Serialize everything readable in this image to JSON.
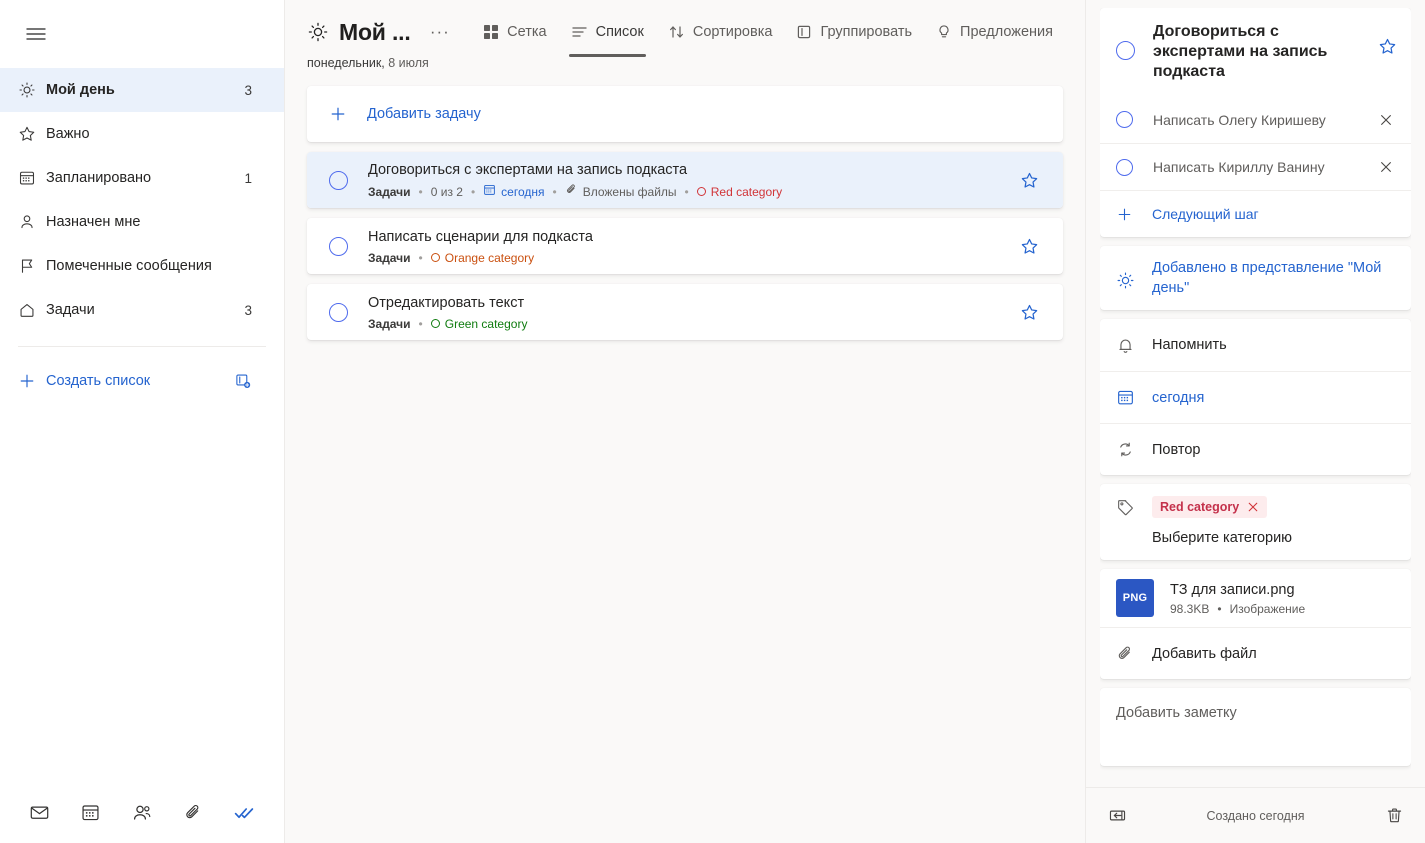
{
  "colors": {
    "accent": "#2564cf",
    "selected_bg": "#eaf1fb",
    "app_bg": "#faf9f8",
    "red": "#d13438",
    "orange": "#ca5010",
    "green": "#107c10",
    "chip_bg": "#fdeced",
    "chip_text": "#c4314b",
    "png_badge": "#2b57c3"
  },
  "sidebar": {
    "menu_icon": "hamburger-icon",
    "items": [
      {
        "label": "Мой день",
        "count": "3",
        "icon": "sun-icon",
        "selected": true
      },
      {
        "label": "Важно",
        "count": "",
        "icon": "star-icon",
        "selected": false
      },
      {
        "label": "Запланировано",
        "count": "1",
        "icon": "calendar-icon",
        "selected": false
      },
      {
        "label": "Назначен мне",
        "count": "",
        "icon": "person-icon",
        "selected": false
      },
      {
        "label": "Помеченные сообщения",
        "count": "",
        "icon": "flag-icon",
        "selected": false
      },
      {
        "label": "Задачи",
        "count": "3",
        "icon": "home-icon",
        "selected": false
      }
    ],
    "create_list": {
      "label": "Создать список",
      "plus_icon": "plus-icon",
      "new_group_icon": "new-list-group-icon"
    },
    "footer_icons": [
      {
        "icon": "mail-icon",
        "active": false
      },
      {
        "icon": "calendar-icon",
        "active": false
      },
      {
        "icon": "people-icon",
        "active": false
      },
      {
        "icon": "attachment-icon",
        "active": false
      },
      {
        "icon": "tasks-check-icon",
        "active": true
      }
    ]
  },
  "header": {
    "sun_icon": "sun-icon",
    "title": "Мой ...",
    "more_label": "···",
    "subtitle_day": "понедельник,",
    "subtitle_date": " 8 июля",
    "tools": [
      {
        "label": "Сетка",
        "icon": "grid-icon",
        "active": false
      },
      {
        "label": "Список",
        "icon": "list-icon",
        "active": true
      },
      {
        "label": "Сортировка",
        "icon": "sort-icon",
        "active": false
      },
      {
        "label": "Группировать",
        "icon": "group-icon",
        "active": false
      },
      {
        "label": "Предложения",
        "icon": "lightbulb-icon",
        "active": false
      }
    ]
  },
  "main": {
    "add_task_label": "Добавить задачу",
    "tasks": [
      {
        "title": "Договориться с экспертами на запись подкаста",
        "selected": true,
        "meta": {
          "list": "Задачи",
          "steps": "0 из 2",
          "due": "сегодня",
          "attachments": "Вложены файлы",
          "category": "Red category",
          "category_color": "red"
        }
      },
      {
        "title": "Написать сценарии для подкаста",
        "selected": false,
        "meta": {
          "list": "Задачи",
          "steps": "",
          "due": "",
          "attachments": "",
          "category": "Orange category",
          "category_color": "orange"
        }
      },
      {
        "title": "Отредактировать текст",
        "selected": false,
        "meta": {
          "list": "Задачи",
          "steps": "",
          "due": "",
          "attachments": "",
          "category": "Green category",
          "category_color": "green"
        }
      }
    ]
  },
  "detail": {
    "title": "Договориться с экспертами на запись подкаста",
    "steps": [
      {
        "label": "Написать Олегу Киришеву"
      },
      {
        "label": "Написать Кириллу Ванину"
      }
    ],
    "next_step_label": "Следующий шаг",
    "my_day_label": "Добавлено в представление \"Мой день\"",
    "remind_label": "Напомнить",
    "due_label": "сегодня",
    "repeat_label": "Повтор",
    "category_chip": "Red category",
    "category_pick_label": "Выберите категорию",
    "file": {
      "badge": "PNG",
      "name": "ТЗ для записи.png",
      "size": "98.3KB",
      "type": "Изображение"
    },
    "add_file_label": "Добавить файл",
    "note_placeholder": "Добавить заметку",
    "footer": {
      "collapse_icon": "collapse-panel-icon",
      "created_text": "Создано сегодня",
      "delete_icon": "trash-icon"
    }
  }
}
